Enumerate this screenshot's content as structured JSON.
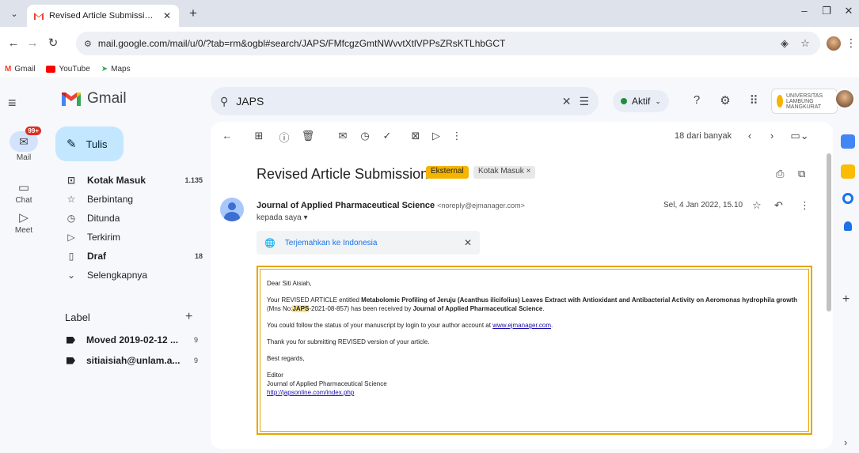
{
  "browser": {
    "tab_title": "Revised Article Submission - siti",
    "url": "mail.google.com/mail/u/0/?tab=rm&ogbl#search/JAPS/FMfcgzGmtNWvvtXtlVPPsZRsKTLhbGCT",
    "bookmarks": [
      "Gmail",
      "YouTube",
      "Maps"
    ]
  },
  "gmail": {
    "logo": "Gmail",
    "search_value": "JAPS",
    "status": "Aktif",
    "org": "UNIVERSITAS LAMBUNG MANGKURAT",
    "rail": {
      "mail_label": "Mail",
      "mail_badge": "99+",
      "chat_label": "Chat",
      "meet_label": "Meet"
    },
    "compose_label": "Tulis",
    "nav": [
      {
        "label": "Kotak Masuk",
        "count": "1.135",
        "icon": "inbox-icon",
        "bold": true
      },
      {
        "label": "Berbintang",
        "count": "",
        "icon": "star-icon",
        "bold": false
      },
      {
        "label": "Ditunda",
        "count": "",
        "icon": "clock-icon",
        "bold": false
      },
      {
        "label": "Terkirim",
        "count": "",
        "icon": "send-icon",
        "bold": false
      },
      {
        "label": "Draf",
        "count": "18",
        "icon": "draft-icon",
        "bold": true
      },
      {
        "label": "Selengkapnya",
        "count": "",
        "icon": "chevron-down-icon",
        "bold": false
      }
    ],
    "labels_header": "Label",
    "labels": [
      {
        "label": "Moved 2019-02-12 ...",
        "count": "9"
      },
      {
        "label": "sitiaisiah@unlam.a...",
        "count": "9"
      }
    ]
  },
  "message": {
    "pager": "18 dari banyak",
    "subject": "Revised Article Submission",
    "chip_external": "Eksternal",
    "chip_inbox": "Kotak Masuk ×",
    "sender_name": "Journal of Applied Pharmaceutical Science",
    "sender_email": "<noreply@ejmanager.com>",
    "to": "kepada saya ▾",
    "date": "Sel, 4 Jan 2022, 15.10",
    "translate": "Terjemahkan ke Indonesia",
    "body": {
      "greeting": "Dear Siti Aisiah,",
      "p1_a": "Your REVISED ARTICLE entitled ",
      "p1_title": "Metabolomic Profiling of Jeruju (Acanthus ilicifolius) Leaves Extract with Antioxidant and Antibacterial Activity on Aeromonas hydrophila growth",
      "p1_b": " (Mns No:",
      "p1_hl": "JAPS",
      "p1_c": "-2021-08-857) has been received by ",
      "p1_journal": "Journal of Applied Pharmaceutical Science",
      "p1_d": ".",
      "p2_a": "You could follow the status of your manuscript by login to your author account at ",
      "p2_link": "www.ejmanager.com",
      "p2_b": ".",
      "p3": "Thank you for submitting REVISED version of your article.",
      "p4": "Best regards,",
      "sig1": "Editor",
      "sig2": "Journal of Applied Pharmaceutical Science",
      "sig_link": "http://japsonline.com/index.php"
    }
  }
}
